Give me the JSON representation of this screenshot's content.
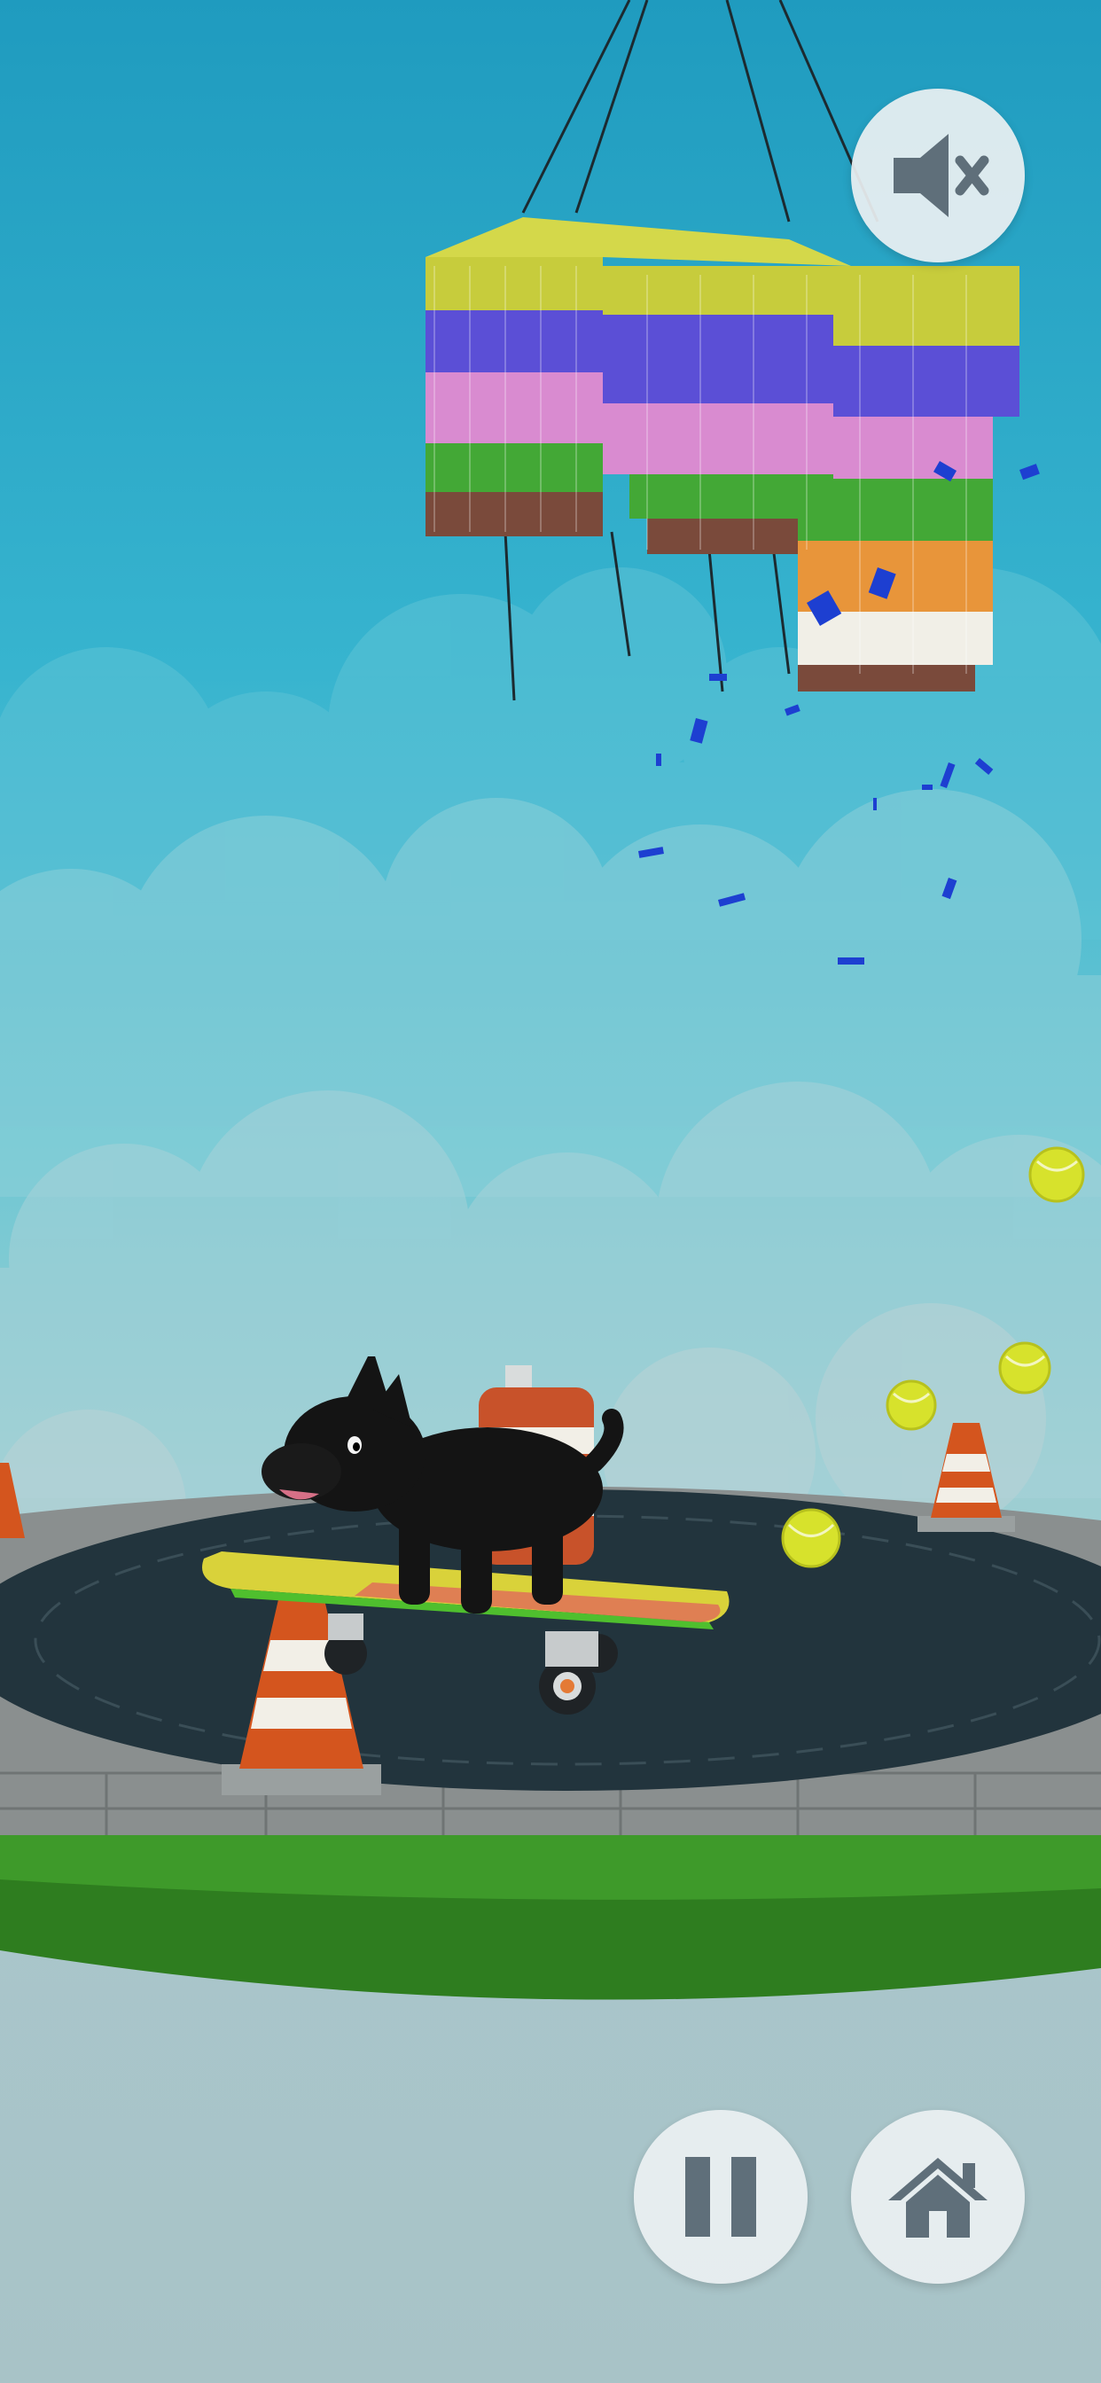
{
  "controls": {
    "sound": {
      "icon": "speaker-muted-icon",
      "state": "muted"
    },
    "pause": {
      "icon": "pause-icon"
    },
    "home": {
      "icon": "home-icon"
    }
  },
  "colors": {
    "sky_top": "#1f9bbf",
    "sky_bottom": "#a8c3c7",
    "button_bg": "#ebf0f2",
    "button_icon": "#5f6f7a",
    "grass": "#2e7d1f",
    "track": "#22343d",
    "cone_orange": "#d4551e"
  },
  "scene": {
    "character": "black-dog-on-skateboard",
    "pinata": "colorful-pinata",
    "collectibles": "tennis-balls",
    "obstacles": "traffic-cones"
  }
}
